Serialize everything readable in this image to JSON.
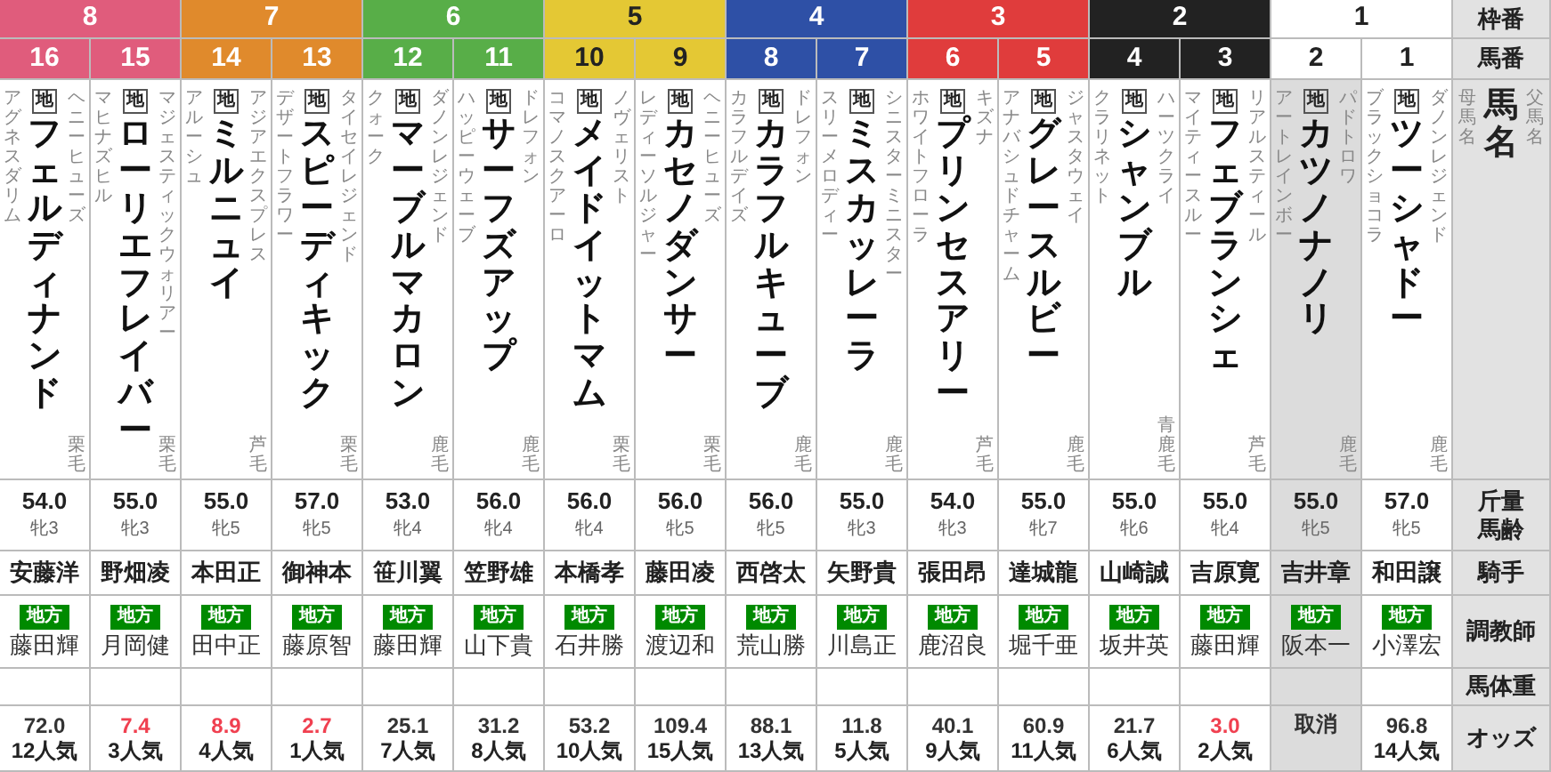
{
  "labels": {
    "frame": "枠番",
    "number": "馬番",
    "sire": "父馬名",
    "name": "馬名",
    "dam": "母馬名",
    "weight": "斤量",
    "age": "馬齢",
    "jockey": "騎手",
    "trainer": "調教師",
    "body_weight": "馬体重",
    "odds": "オッズ"
  },
  "frames": [
    {
      "number": "8",
      "color": "#e05c7c",
      "horses": [
        {
          "number": "16",
          "name": "フェルディナンド",
          "local_mark": "地",
          "sire": "ヘニーヒューズ",
          "dam": "アグネスダリム",
          "coat": "栗毛",
          "weight": "54.0",
          "sex_age": "牝3",
          "jockey": "安藤洋",
          "affiliation": "地方",
          "trainer": "藤田輝",
          "odds": "72.0",
          "popularity": "12人気",
          "hot": false,
          "scratched": false
        },
        {
          "number": "15",
          "name": "ローリエフレイバー",
          "local_mark": "地",
          "sire": "マジェスティックウォリアー",
          "dam": "マヒナズヒル",
          "coat": "栗毛",
          "weight": "55.0",
          "sex_age": "牝3",
          "jockey": "野畑凌",
          "affiliation": "地方",
          "trainer": "月岡健",
          "odds": "7.4",
          "popularity": "3人気",
          "hot": true,
          "scratched": false
        }
      ]
    },
    {
      "number": "7",
      "color": "#e08a2c",
      "horses": [
        {
          "number": "14",
          "name": "ミルニュイ",
          "local_mark": "地",
          "sire": "アジアエクスプレス",
          "dam": "アルーシュ",
          "coat": "芦毛",
          "weight": "55.0",
          "sex_age": "牝5",
          "jockey": "本田正",
          "affiliation": "地方",
          "trainer": "田中正",
          "odds": "8.9",
          "popularity": "4人気",
          "hot": true,
          "scratched": false
        },
        {
          "number": "13",
          "name": "スピーディキック",
          "local_mark": "地",
          "sire": "タイセイレジェンド",
          "dam": "デザートフラワー",
          "coat": "栗毛",
          "weight": "57.0",
          "sex_age": "牝5",
          "jockey": "御神本",
          "affiliation": "地方",
          "trainer": "藤原智",
          "odds": "2.7",
          "popularity": "1人気",
          "hot": true,
          "scratched": false
        }
      ]
    },
    {
      "number": "6",
      "color": "#58ae48",
      "horses": [
        {
          "number": "12",
          "name": "マーブルマカロン",
          "local_mark": "地",
          "sire": "ダノンレジェンド",
          "dam": "クォーク",
          "coat": "鹿毛",
          "weight": "53.0",
          "sex_age": "牝4",
          "jockey": "笹川翼",
          "affiliation": "地方",
          "trainer": "藤田輝",
          "odds": "25.1",
          "popularity": "7人気",
          "hot": false,
          "scratched": false
        },
        {
          "number": "11",
          "name": "サーフズアップ",
          "local_mark": "地",
          "sire": "ドレフォン",
          "dam": "ハッピーウェーブ",
          "coat": "鹿毛",
          "weight": "56.0",
          "sex_age": "牝4",
          "jockey": "笠野雄",
          "affiliation": "地方",
          "trainer": "山下貴",
          "odds": "31.2",
          "popularity": "8人気",
          "hot": false,
          "scratched": false
        }
      ]
    },
    {
      "number": "5",
      "color": "#e4c834",
      "horses": [
        {
          "number": "10",
          "name": "メイドイットマム",
          "local_mark": "地",
          "sire": "ノヴェリスト",
          "dam": "コマノスクアーロ",
          "coat": "栗毛",
          "weight": "56.0",
          "sex_age": "牝4",
          "jockey": "本橋孝",
          "affiliation": "地方",
          "trainer": "石井勝",
          "odds": "53.2",
          "popularity": "10人気",
          "hot": false,
          "scratched": false
        },
        {
          "number": "9",
          "name": "カセノダンサー",
          "local_mark": "地",
          "sire": "ヘニーヒューズ",
          "dam": "レディーソルジャー",
          "coat": "栗毛",
          "weight": "56.0",
          "sex_age": "牝5",
          "jockey": "藤田凌",
          "affiliation": "地方",
          "trainer": "渡辺和",
          "odds": "109.4",
          "popularity": "15人気",
          "hot": false,
          "scratched": false
        }
      ]
    },
    {
      "number": "4",
      "color": "#2e50a6",
      "horses": [
        {
          "number": "8",
          "name": "カラフルキューブ",
          "local_mark": "地",
          "sire": "ドレフォン",
          "dam": "カラフルデイズ",
          "coat": "鹿毛",
          "weight": "56.0",
          "sex_age": "牝5",
          "jockey": "西啓太",
          "affiliation": "地方",
          "trainer": "荒山勝",
          "odds": "88.1",
          "popularity": "13人気",
          "hot": false,
          "scratched": false
        },
        {
          "number": "7",
          "name": "ミスカッレーラ",
          "local_mark": "地",
          "sire": "シニスターミニスター",
          "dam": "スリーメロディー",
          "coat": "鹿毛",
          "weight": "55.0",
          "sex_age": "牝3",
          "jockey": "矢野貴",
          "affiliation": "地方",
          "trainer": "川島正",
          "odds": "11.8",
          "popularity": "5人気",
          "hot": false,
          "scratched": false
        }
      ]
    },
    {
      "number": "3",
      "color": "#e03c3c",
      "horses": [
        {
          "number": "6",
          "name": "プリンセスアリー",
          "local_mark": "地",
          "sire": "キズナ",
          "dam": "ホワイトフローラ",
          "coat": "芦毛",
          "weight": "54.0",
          "sex_age": "牝3",
          "jockey": "張田昂",
          "affiliation": "地方",
          "trainer": "鹿沼良",
          "odds": "40.1",
          "popularity": "9人気",
          "hot": false,
          "scratched": false
        },
        {
          "number": "5",
          "name": "グレースルビー",
          "local_mark": "地",
          "sire": "ジャスタウェイ",
          "dam": "アナバシュドチャーム",
          "coat": "鹿毛",
          "weight": "55.0",
          "sex_age": "牝7",
          "jockey": "達城龍",
          "affiliation": "地方",
          "trainer": "堀千亜",
          "odds": "60.9",
          "popularity": "11人気",
          "hot": false,
          "scratched": false
        }
      ]
    },
    {
      "number": "2",
      "color": "#222222",
      "horses": [
        {
          "number": "4",
          "name": "シャンブル",
          "local_mark": "地",
          "sire": "ハーツクライ",
          "dam": "クラリネット",
          "coat": "青鹿毛",
          "weight": "55.0",
          "sex_age": "牝6",
          "jockey": "山崎誠",
          "affiliation": "地方",
          "trainer": "坂井英",
          "odds": "21.7",
          "popularity": "6人気",
          "hot": false,
          "scratched": false
        },
        {
          "number": "3",
          "name": "フェブランシェ",
          "local_mark": "地",
          "sire": "リアルスティール",
          "dam": "マイティースルー",
          "coat": "芦毛",
          "weight": "55.0",
          "sex_age": "牝4",
          "jockey": "吉原寛",
          "affiliation": "地方",
          "trainer": "藤田輝",
          "odds": "3.0",
          "popularity": "2人気",
          "hot": true,
          "scratched": false
        }
      ]
    },
    {
      "number": "1",
      "color": "#ffffff",
      "horses": [
        {
          "number": "2",
          "name": "カツノナノリ",
          "local_mark": "地",
          "sire": "パドトロワ",
          "dam": "アートレインボー",
          "coat": "鹿毛",
          "weight": "55.0",
          "sex_age": "牝5",
          "jockey": "吉井章",
          "affiliation": "地方",
          "trainer": "阪本一",
          "odds": "取消",
          "hot": false,
          "scratched": true
        },
        {
          "number": "1",
          "name": "ツーシャドー",
          "local_mark": "地",
          "sire": "ダノンレジェンド",
          "dam": "ブラックショコラ",
          "coat": "鹿毛",
          "weight": "57.0",
          "sex_age": "牝5",
          "jockey": "和田譲",
          "affiliation": "地方",
          "trainer": "小澤宏",
          "odds": "96.8",
          "popularity": "14人気",
          "hot": false,
          "scratched": false
        }
      ]
    }
  ]
}
